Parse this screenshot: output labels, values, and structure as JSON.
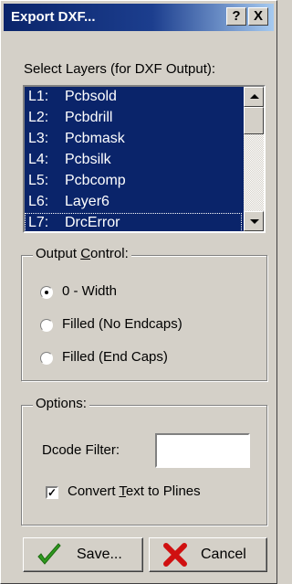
{
  "window": {
    "title": "Export DXF...",
    "help_glyph": "?",
    "close_glyph": "X"
  },
  "layers": {
    "label": "Select Layers (for DXF Output):",
    "items": [
      {
        "code": "L1:",
        "name": "Pcbsold"
      },
      {
        "code": "L2:",
        "name": "Pcbdrill"
      },
      {
        "code": "L3:",
        "name": "Pcbmask"
      },
      {
        "code": "L4:",
        "name": "Pcbsilk"
      },
      {
        "code": "L5:",
        "name": "Pcbcomp"
      },
      {
        "code": "L6:",
        "name": "Layer6"
      },
      {
        "code": "L7:",
        "name": "DrcError"
      }
    ]
  },
  "output_control": {
    "legend_pre": "Output ",
    "legend_ul": "C",
    "legend_post": "ontrol:",
    "options": [
      "0 - Width",
      "Filled (No Endcaps)",
      "Filled (End Caps)"
    ],
    "selected": "0 - Width"
  },
  "options": {
    "legend": "Options:",
    "dcode_label": "Dcode Filter:",
    "dcode_value": "",
    "convert_pre": "Convert ",
    "convert_ul": "T",
    "convert_post": "ext to Plines",
    "convert_checked": true,
    "check_glyph": "✓"
  },
  "buttons": {
    "save": "Save...",
    "cancel": "Cancel"
  },
  "colors": {
    "selection": "#0a246a",
    "title_start": "#0a246a",
    "title_end": "#a6caf0",
    "save_icon": "#2e9a1e",
    "cancel_icon": "#d01010"
  }
}
